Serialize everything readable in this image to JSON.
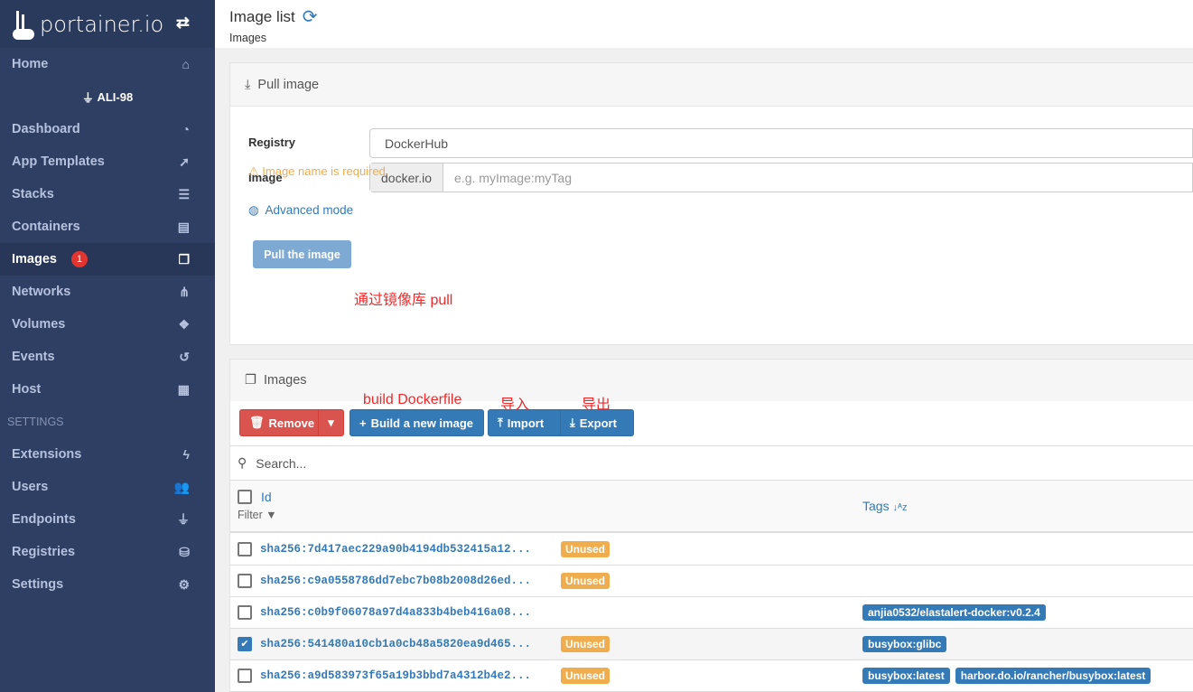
{
  "sidebar": {
    "logo": "portainer.io",
    "home": "Home",
    "endpoint": "ALI-98",
    "items": [
      {
        "label": "Dashboard",
        "icon": "tachometer"
      },
      {
        "label": "App Templates",
        "icon": "rocket"
      },
      {
        "label": "Stacks",
        "icon": "th-list"
      },
      {
        "label": "Containers",
        "icon": "server"
      },
      {
        "label": "Images",
        "icon": "clone",
        "badge": "1"
      },
      {
        "label": "Networks",
        "icon": "sitemap"
      },
      {
        "label": "Volumes",
        "icon": "cubes"
      },
      {
        "label": "Events",
        "icon": "history"
      },
      {
        "label": "Host",
        "icon": "th"
      }
    ],
    "settings_label": "SETTINGS",
    "settings": [
      {
        "label": "Extensions",
        "icon": "bolt"
      },
      {
        "label": "Users",
        "icon": "users"
      },
      {
        "label": "Endpoints",
        "icon": "plug"
      },
      {
        "label": "Registries",
        "icon": "database"
      },
      {
        "label": "Settings",
        "icon": "cogs"
      }
    ]
  },
  "header": {
    "title": "Image list",
    "subtitle": "Images"
  },
  "pull": {
    "title": "Pull image",
    "registry_label": "Registry",
    "registry_value": "DockerHub",
    "image_label": "Image",
    "image_prefix": "docker.io",
    "image_placeholder": "e.g. myImage:myTag",
    "warning": "Image name is required.",
    "advanced": "Advanced mode",
    "button": "Pull the image",
    "annotation": "通过镜像库 pull"
  },
  "images": {
    "title": "Images",
    "remove": "Remove",
    "build": "Build a new image",
    "import": "Import",
    "export": "Export",
    "search_placeholder": "Search...",
    "col_id": "Id",
    "filter": "Filter",
    "col_tags": "Tags",
    "annotations": {
      "build": "build Dockerfile",
      "import": "导入",
      "export": "导出"
    },
    "rows": [
      {
        "id": "sha256:7d417aec229a90b4194db532415a12...",
        "unused": "Unused",
        "tags": [],
        "checked": false
      },
      {
        "id": "sha256:c9a0558786dd7ebc7b08b2008d26ed...",
        "unused": "Unused",
        "tags": [],
        "checked": false
      },
      {
        "id": "sha256:c0b9f06078a97d4a833b4beb416a08...",
        "unused": null,
        "tags": [
          "anjia0532/elastalert-docker:v0.2.4"
        ],
        "checked": false
      },
      {
        "id": "sha256:541480a10cb1a0cb48a5820ea9d465...",
        "unused": "Unused",
        "tags": [
          "busybox:glibc"
        ],
        "checked": true
      },
      {
        "id": "sha256:a9d583973f65a19b3bbd7a4312b4e2...",
        "unused": "Unused",
        "tags": [
          "busybox:latest",
          "harbor.do.io/rancher/busybox:latest"
        ],
        "checked": false
      }
    ]
  }
}
